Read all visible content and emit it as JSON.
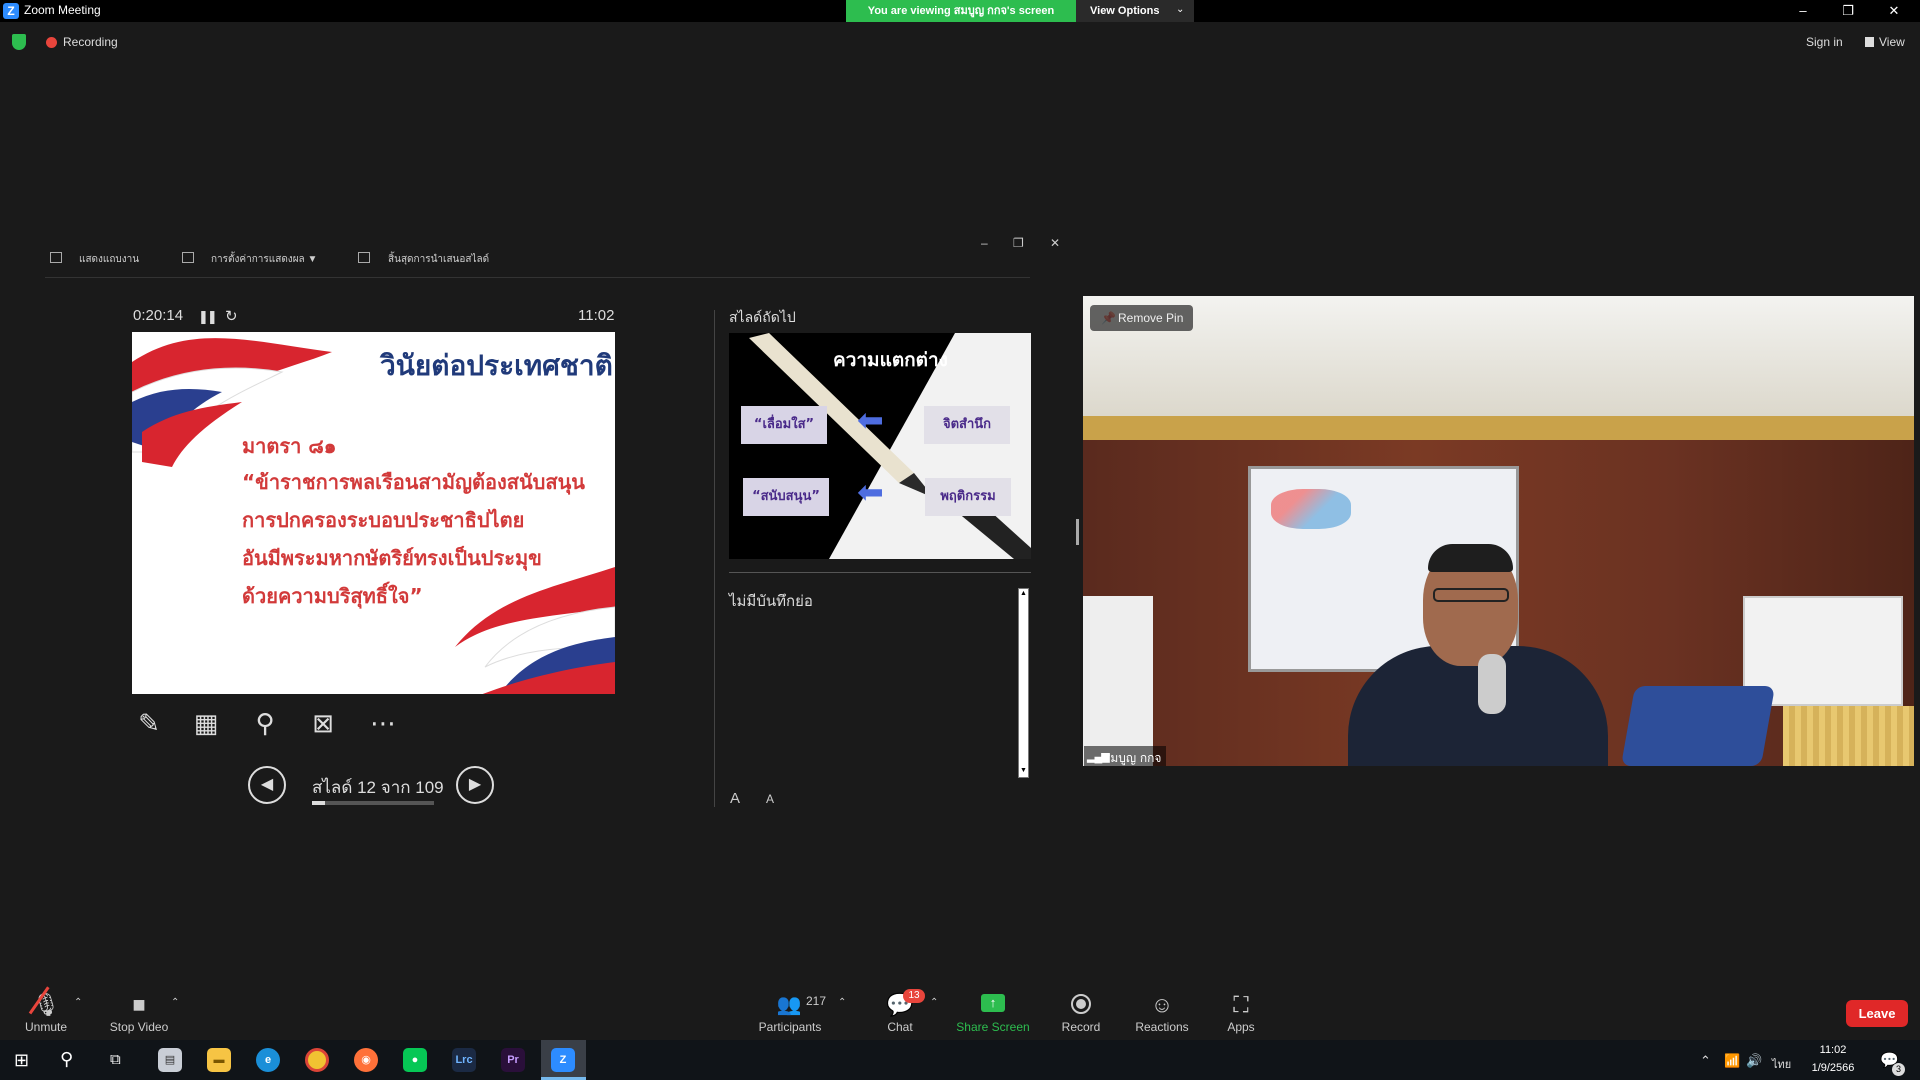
{
  "window": {
    "app_logo": "Z",
    "title": "Zoom Meeting",
    "viewing_banner": "You are viewing สมบูญ กกจ's screen",
    "view_options": "View Options",
    "minimize": "–",
    "restore": "❐",
    "close": "✕"
  },
  "status": {
    "recording": "Recording",
    "sign_in": "Sign in",
    "view": "View"
  },
  "presenter": {
    "toolbar": {
      "show_taskbar": "แสดงแถบงาน",
      "display_settings": "การตั้งค่าการแสดงผล ▼",
      "end_slideshow": "สิ้นสุดการนำเสนอสไลด์"
    },
    "elapsed": "0:20:14",
    "clock": "11:02",
    "current_slide": {
      "title": "วินัยต่อประเทศชาติ",
      "lines": [
        "มาตรา ๘๑",
        "“ข้าราชการพลเรือนสามัญต้องสนับสนุน",
        "การปกครองระบอบประชาธิปไตย",
        "อันมีพระมหากษัตริย์ทรงเป็นประมุข",
        "ด้วยความบริสุทธิ์ใจ”"
      ]
    },
    "slide_counter": "สไลด์ 12 จาก 109",
    "slide_progress": 0.11,
    "next_slide_label": "สไลด์ถัดไป",
    "next_slide": {
      "title": "ความแตกต่าง",
      "box1": "“เลื่อมใส”",
      "box2": "จิตสำนึก",
      "box3": "“สนับสนุน”",
      "box4": "พฤติกรรม"
    },
    "notes": "ไม่มีบันทึกย่อ",
    "font_up": "A",
    "font_down": "A"
  },
  "video": {
    "remove_pin": "Remove Pin",
    "participant_name": "สมบูญ กกจ"
  },
  "controls": {
    "unmute": "Unmute",
    "stop_video": "Stop Video",
    "participants": "Participants",
    "participants_count": "217",
    "chat": "Chat",
    "chat_badge": "13",
    "share_screen": "Share Screen",
    "record": "Record",
    "reactions": "Reactions",
    "apps": "Apps",
    "leave": "Leave"
  },
  "taskbar": {
    "lang": "ไทย",
    "time": "11:02",
    "date": "1/9/2566",
    "notifications": "3",
    "apps": [
      {
        "name": "lrc",
        "label": "Lrc",
        "bg": "#1b2a44",
        "fg": "#6fb4ff"
      },
      {
        "name": "premiere",
        "label": "Pr",
        "bg": "#2a0f3a",
        "fg": "#c79cff"
      }
    ]
  },
  "colors": {
    "zoom_blue": "#2d8cff",
    "zoom_green": "#2dbd4f",
    "leave_red": "#e02828"
  }
}
